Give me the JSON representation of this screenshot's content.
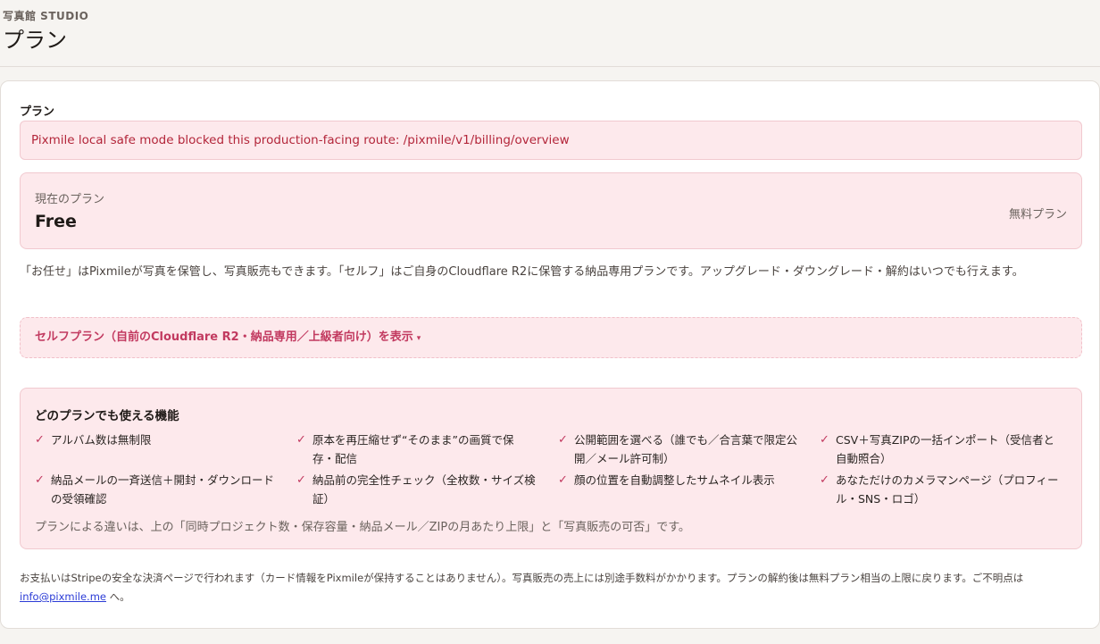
{
  "header": {
    "brand": "写真館 STUDIO",
    "title": "プラン"
  },
  "main": {
    "section_label": "プラン",
    "error_message": "Pixmile local safe mode blocked this production-facing route: /pixmile/v1/billing/overview",
    "current_plan": {
      "caption": "現在のプラン",
      "name": "Free",
      "badge": "無料プラン"
    },
    "description": "「お任せ」はPixmileが写真を保管し、写真販売もできます。「セルフ」はご自身のCloudflare R2に保管する納品専用プランです。アップグレード・ダウングレード・解約はいつでも行えます。",
    "self_plan_toggle": {
      "label": "セルフプラン（自前のCloudflare R2・納品専用／上級者向け）を表示",
      "caret": "▾"
    },
    "features": {
      "title": "どのプランでも使える機能",
      "check_mark": "✓",
      "items": [
        "アルバム数は無制限",
        "原本を再圧縮せず“そのまま”の画質で保存・配信",
        "公開範囲を選べる（誰でも／合言葉で限定公開／メール許可制）",
        "CSV＋写真ZIPの一括インポート（受信者と自動照合）",
        "納品メールの一斉送信＋開封・ダウンロードの受領確認",
        "納品前の完全性チェック（全枚数・サイズ検証）",
        "顔の位置を自動調整したサムネイル表示",
        "あなただけのカメラマンページ（プロフィール・SNS・ロゴ）"
      ],
      "note": "プランによる違いは、上の「同時プロジェクト数・保存容量・納品メール／ZIPの月あたり上限」と「写真販売の可否」です。"
    },
    "footer": {
      "text": "お支払いはStripeの安全な決済ページで行われます（カード情報をPixmileが保持することはありません）。写真販売の売上には別途手数料がかかります。プランの解約後は無料プラン相当の上限に戻ります。ご不明点は",
      "email": "info@pixmile.me",
      "suffix": " へ。"
    }
  },
  "colors": {
    "accent": "#c23a60",
    "error_text": "#b3263a",
    "panel_bg": "#fde9ec",
    "link": "#2b3bd6"
  }
}
